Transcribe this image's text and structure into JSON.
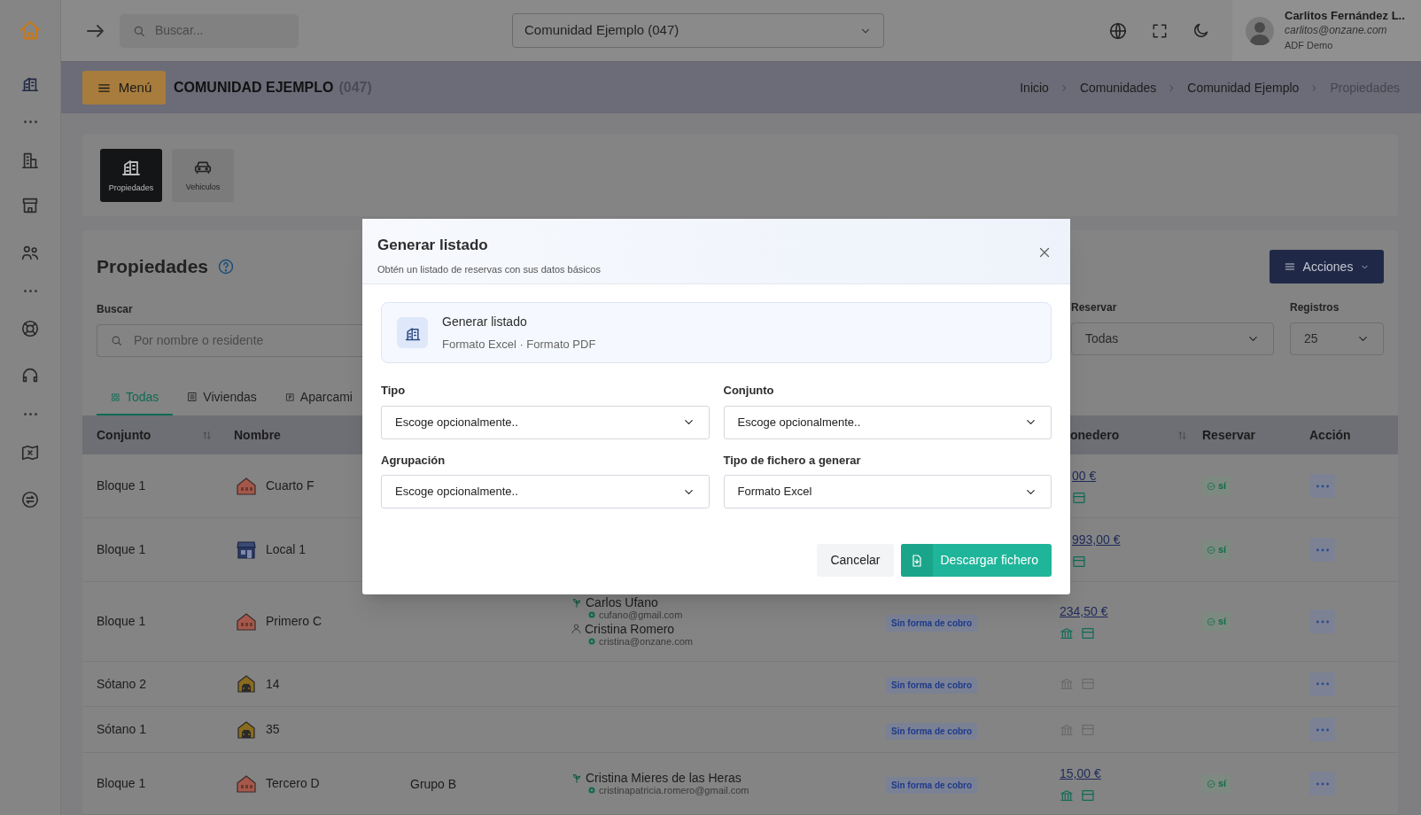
{
  "topbar": {
    "search": {
      "placeholder": "Buscar..."
    },
    "community_select": {
      "value": "Comunidad Ejemplo (047)"
    },
    "user": {
      "name": "Carlitos Fernández L..",
      "email": "carlitos@onzane.com",
      "role": "ADF Demo"
    }
  },
  "header": {
    "menu_button": "Menú",
    "title": "COMUNIDAD EJEMPLO",
    "code": "(047)",
    "breadcrumbs": [
      {
        "label": "Inicio",
        "current": false
      },
      {
        "label": "Comunidades",
        "current": false
      },
      {
        "label": "Comunidad Ejemplo",
        "current": false
      },
      {
        "label": "Propiedades",
        "current": true
      }
    ]
  },
  "section_tiles": [
    {
      "label": "Propiedades",
      "kind": "propiedades",
      "selected": true
    },
    {
      "label": "Vehiculos",
      "kind": "vehiculos",
      "selected": false
    }
  ],
  "panel": {
    "title": "Propiedades",
    "actions_button": "Acciones",
    "search": {
      "label": "Buscar",
      "placeholder": "Por nombre o residente"
    },
    "filters": [
      {
        "label": "Reservar",
        "value": "Todas"
      },
      {
        "label": "Registros",
        "value": "25"
      }
    ],
    "tabs": [
      {
        "label": "Todas",
        "kind": "todas",
        "selected": true
      },
      {
        "label": "Viviendas",
        "kind": "viviendas",
        "selected": false
      },
      {
        "label": "Aparcami",
        "kind": "aparcamientos",
        "selected": false
      }
    ]
  },
  "table": {
    "columns": [
      {
        "label": "Conjunto",
        "sortable": true
      },
      {
        "label": "Nombre",
        "sortable": false
      },
      {
        "label": "onedero",
        "sortable": true
      },
      {
        "label": "Reservar",
        "sortable": false
      },
      {
        "label": "Acción",
        "sortable": false
      }
    ],
    "rows": [
      {
        "conjunto": "Bloque 1",
        "nombre": "Cuarto F",
        "kind": "vivienda",
        "monedero": "00 €",
        "bank_icon": false,
        "icons_active": true,
        "reservar": "sí"
      },
      {
        "conjunto": "Bloque 1",
        "nombre": "Local 1",
        "kind": "local",
        "monedero": "993,00 €",
        "bank_icon": false,
        "icons_active": true,
        "reservar": "sí"
      },
      {
        "conjunto": "Bloque 1",
        "nombre": "Primero C",
        "kind": "vivienda",
        "residents": [
          {
            "name": "Carlos Ufano",
            "email": "cufano@gmail.com",
            "kind": "owner"
          },
          {
            "name": "Cristina Romero",
            "email": "cristina@onzane.com",
            "kind": "tenant"
          }
        ],
        "payment_badge": "Sin forma de cobro",
        "monedero": "234,50 €",
        "bank_icon": true,
        "icons_active": true,
        "reservar": "sí"
      },
      {
        "conjunto": "Sótano 2",
        "nombre": "14",
        "kind": "aparcamiento",
        "payment_badge": "Sin forma de cobro",
        "bank_icon": true,
        "icons_active": false
      },
      {
        "conjunto": "Sótano 1",
        "nombre": "35",
        "kind": "aparcamiento",
        "payment_badge": "Sin forma de cobro",
        "bank_icon": true,
        "icons_active": false
      },
      {
        "conjunto": "Bloque 1",
        "nombre": "Tercero D",
        "kind": "vivienda",
        "agrupacion": "Grupo B",
        "residents": [
          {
            "name": "Cristina Mieres de las Heras",
            "email": "cristinapatricia.romero@gmail.com",
            "kind": "owner"
          }
        ],
        "payment_badge": "Sin forma de cobro",
        "monedero": "15,00 €",
        "bank_icon": true,
        "icons_active": true,
        "reservar": "sí"
      }
    ]
  },
  "modal": {
    "title": "Generar listado",
    "subtitle": "Obtén un listado de reservas con sus datos básicos",
    "info": {
      "title": "Generar listado",
      "formats": "Formato Excel · Formato PDF"
    },
    "fields": [
      {
        "label": "Tipo",
        "value": "Escoge opcionalmente.."
      },
      {
        "label": "Conjunto",
        "value": "Escoge opcionalmente.."
      },
      {
        "label": "Agrupación",
        "value": "Escoge opcionalmente.."
      },
      {
        "label": "Tipo de fichero a generar",
        "value": "Formato Excel"
      }
    ],
    "buttons": [
      {
        "label": "Cancelar",
        "kind": "secondary"
      },
      {
        "label": "Descargar fichero",
        "kind": "primary"
      }
    ]
  }
}
